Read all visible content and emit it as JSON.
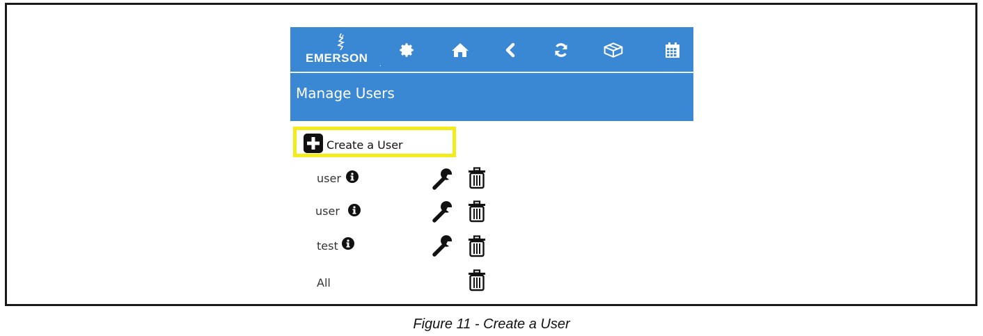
{
  "header": {
    "brand": "EMERSON",
    "nav_icons": [
      "gear-icon",
      "home-icon",
      "chevron-left-icon",
      "refresh-icon",
      "cube-icon",
      "calendar-icon"
    ]
  },
  "page": {
    "title": "Manage Users"
  },
  "actions": {
    "create_user_label": "Create a User"
  },
  "users": [
    {
      "name": "user",
      "has_edit": true
    },
    {
      "name": "user",
      "has_edit": true
    },
    {
      "name": "test",
      "has_edit": true
    }
  ],
  "all_row": {
    "label": "All"
  },
  "caption": "Figure 11 - Create a User",
  "colors": {
    "header_blue": "#3a87d4",
    "highlight_yellow": "#f2ec1c"
  }
}
